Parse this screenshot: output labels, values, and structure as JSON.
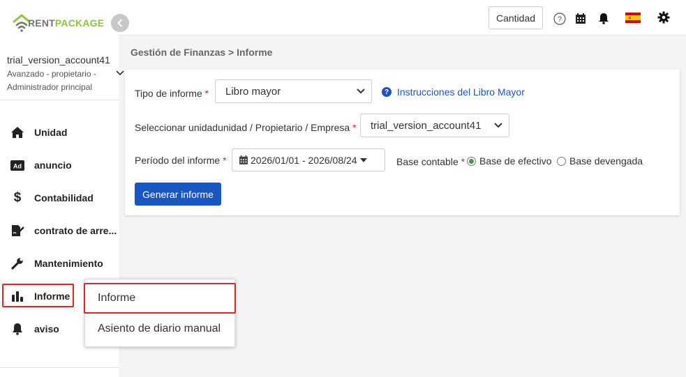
{
  "brand": {
    "rent": "RENT",
    "package": "PACKAGE"
  },
  "account": {
    "name": "trial_version_account41",
    "role": "Avanzado - propietario - Administrador principal"
  },
  "sidebar": {
    "items": [
      {
        "label": "Unidad",
        "icon": "home-icon"
      },
      {
        "label": "anuncio",
        "icon": "ad-icon"
      },
      {
        "label": "Contabilidad",
        "icon": "dollar-icon"
      },
      {
        "label": "contrato de arre...",
        "icon": "contract-icon"
      },
      {
        "label": "Mantenimiento",
        "icon": "wrench-icon"
      },
      {
        "label": "Informe",
        "icon": "bar-chart-icon"
      },
      {
        "label": "aviso",
        "icon": "bell-icon"
      }
    ]
  },
  "topbar": {
    "cantidad_label": "Cantidad",
    "icons": [
      "help-icon",
      "calendar-icon",
      "bell-icon",
      "spain-flag-icon",
      "gear-icon"
    ]
  },
  "breadcrumb": "Gestión de Finanzas > Informe",
  "form": {
    "report_type_label": "Tipo de informe",
    "report_type_value": "Libro mayor",
    "help_link": "Instrucciones del Libro Mayor",
    "select_unit_label": "Seleccionar unidadunidad / Propietario / Empresa",
    "select_unit_value": "trial_version_account41",
    "period_label": "Período del informe",
    "period_value": "2026/01/01 - 2026/08/24",
    "basis_label": "Base contable",
    "basis_options": [
      "Base de efectivo",
      "Base devengada"
    ],
    "basis_selected": "Base de efectivo",
    "generate_button": "Generar informe",
    "required_mark": "*"
  },
  "submenu": {
    "items": [
      "Informe",
      "Asiento de diario manual"
    ]
  },
  "colors": {
    "accent": "#1a56c2",
    "highlight_outline": "#d9252b",
    "brand_green": "#8cc63f"
  }
}
